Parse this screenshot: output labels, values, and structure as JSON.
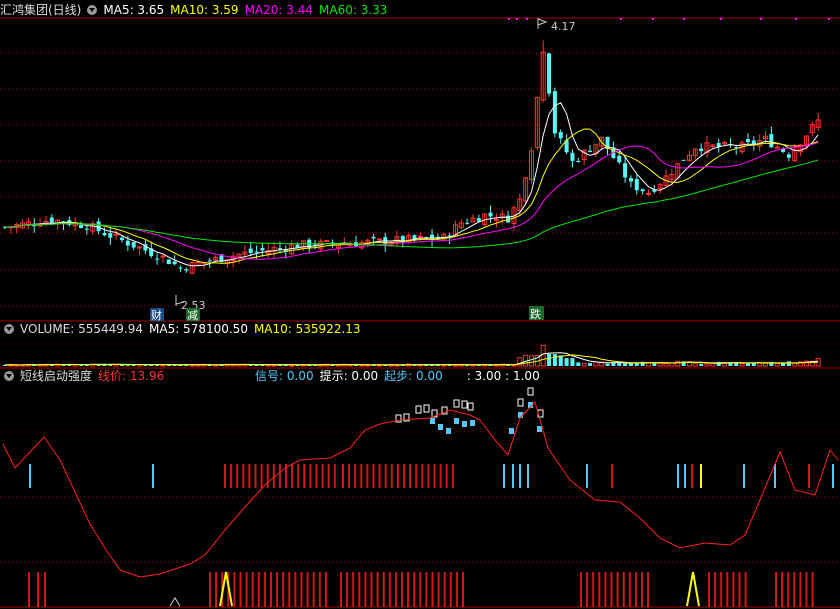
{
  "main": {
    "title": "汇鸿集团(日线)",
    "ma5": "MA5: 3.65",
    "ma10": "MA10: 3.59",
    "ma20": "MA20: 3.44",
    "ma60": "MA60: 3.33",
    "high_label": "4.17",
    "low_label": "2.53",
    "marker_cai": "财",
    "marker_jian": "减",
    "marker_die": "跌"
  },
  "volume": {
    "label": "VOLUME: 555449.94",
    "ma5": "MA5: 578100.50",
    "ma10": "MA10: 535922.13"
  },
  "indicator": {
    "title": "短线启动强度",
    "price": "线价: 13.96",
    "signal": "信号: 0.00",
    "hint": "提示: 0.00",
    "start": "起步: 0.00",
    "ratio": ": 3.00 : 1.00"
  },
  "colors": {
    "up": "#ff3232",
    "down": "#54fcfc",
    "ma5": "#ffffff",
    "ma10": "#ffff00",
    "ma20": "#ff00ff",
    "ma60": "#00e600",
    "line": "#ff2020",
    "grid": "#a00000"
  },
  "chart_data": {
    "type": "candlestick",
    "price_range": [
      2.4,
      4.3
    ],
    "high": 4.17,
    "low": 2.53,
    "volume_range": [
      0,
      1600000
    ],
    "strength_range": [
      0,
      100
    ],
    "grid": true
  }
}
